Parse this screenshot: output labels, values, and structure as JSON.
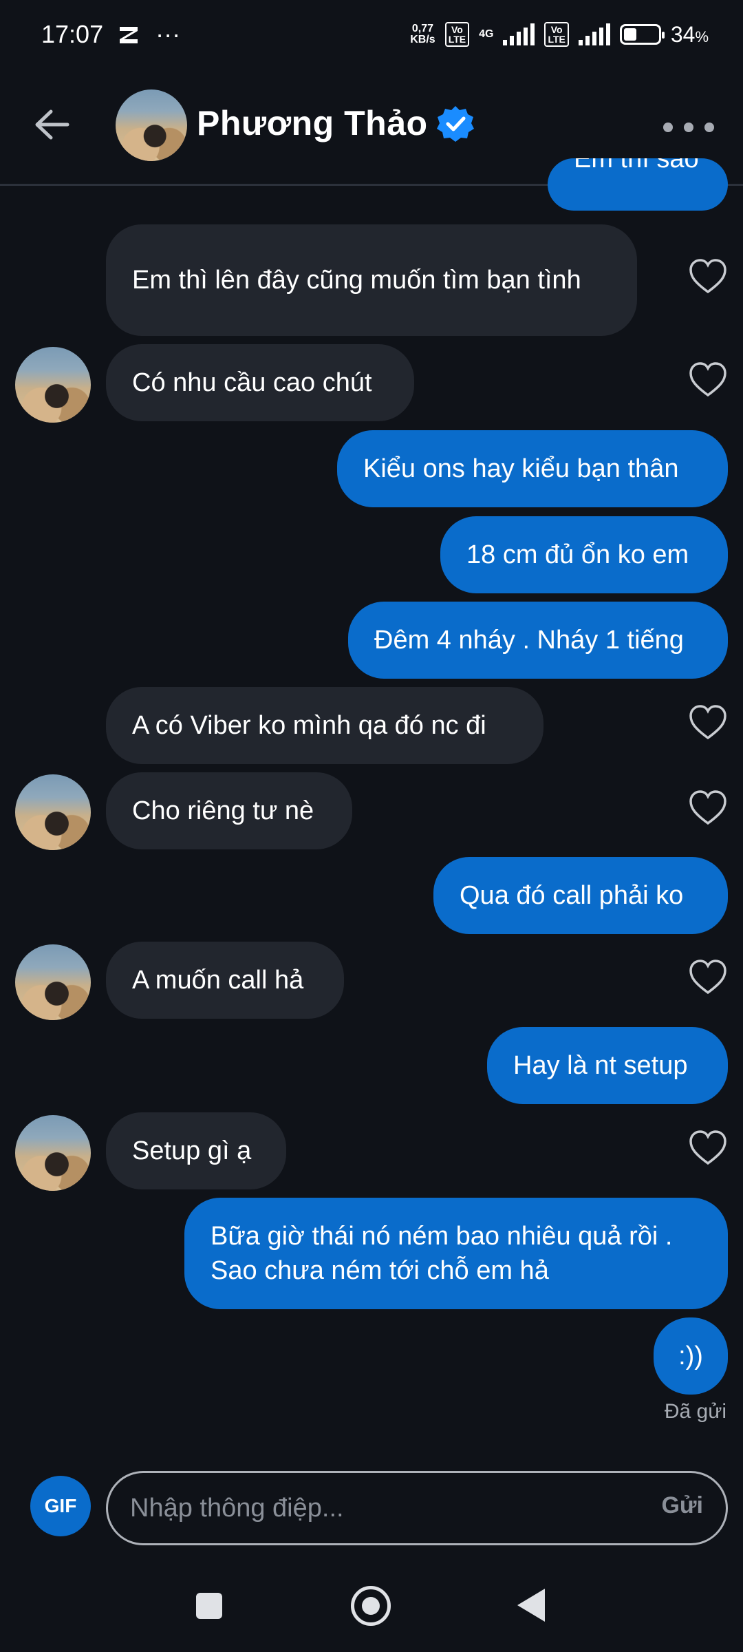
{
  "status_bar": {
    "time": "17:07",
    "more": "···",
    "net_speed_top": "0,77",
    "net_speed_bottom": "KB/s",
    "vo_top": "Vo",
    "vo_bottom": "LTE",
    "network_type": "4G",
    "battery_percent": "34",
    "percent_sign": "%",
    "battery_level": 0.34
  },
  "header": {
    "contact_name": "Phương Thảo",
    "verified": true
  },
  "messages": [
    {
      "side": "out",
      "text": "Em thì sao",
      "partial": true
    },
    {
      "side": "in",
      "text": "Em thì lên đây cũng muốn tìm bạn tình"
    },
    {
      "side": "in",
      "text": "Có nhu cầu cao chút",
      "avatar": true
    },
    {
      "side": "out",
      "text": "Kiểu ons hay kiểu bạn thân"
    },
    {
      "side": "out",
      "text": "18 cm đủ ổn ko em"
    },
    {
      "side": "out",
      "text": "Đêm 4 nháy . Nháy 1 tiếng"
    },
    {
      "side": "in",
      "text": "A có Viber ko mình qa đó nc đi"
    },
    {
      "side": "in",
      "text": "Cho riêng tư nè",
      "avatar": true
    },
    {
      "side": "out",
      "text": "Qua đó call phải ko"
    },
    {
      "side": "in",
      "text": "A muốn call hả",
      "avatar": true
    },
    {
      "side": "out",
      "text": "Hay là nt setup"
    },
    {
      "side": "in",
      "text": "Setup gì ạ",
      "avatar": true
    },
    {
      "side": "out",
      "text": "Bữa giờ thái nó ném bao nhiêu quả rồi . Sao chưa ném tới chỗ em hả"
    },
    {
      "side": "out",
      "text": ":))"
    }
  ],
  "sent_status": "Đã gửi",
  "composer": {
    "gif_label": "GIF",
    "placeholder": "Nhập thông điệp...",
    "send_label": "Gửi"
  },
  "colors": {
    "background": "#0f1218",
    "incoming_bubble": "#22262e",
    "outgoing_bubble": "#0a6ccb",
    "verified_badge": "#1a8cff"
  }
}
